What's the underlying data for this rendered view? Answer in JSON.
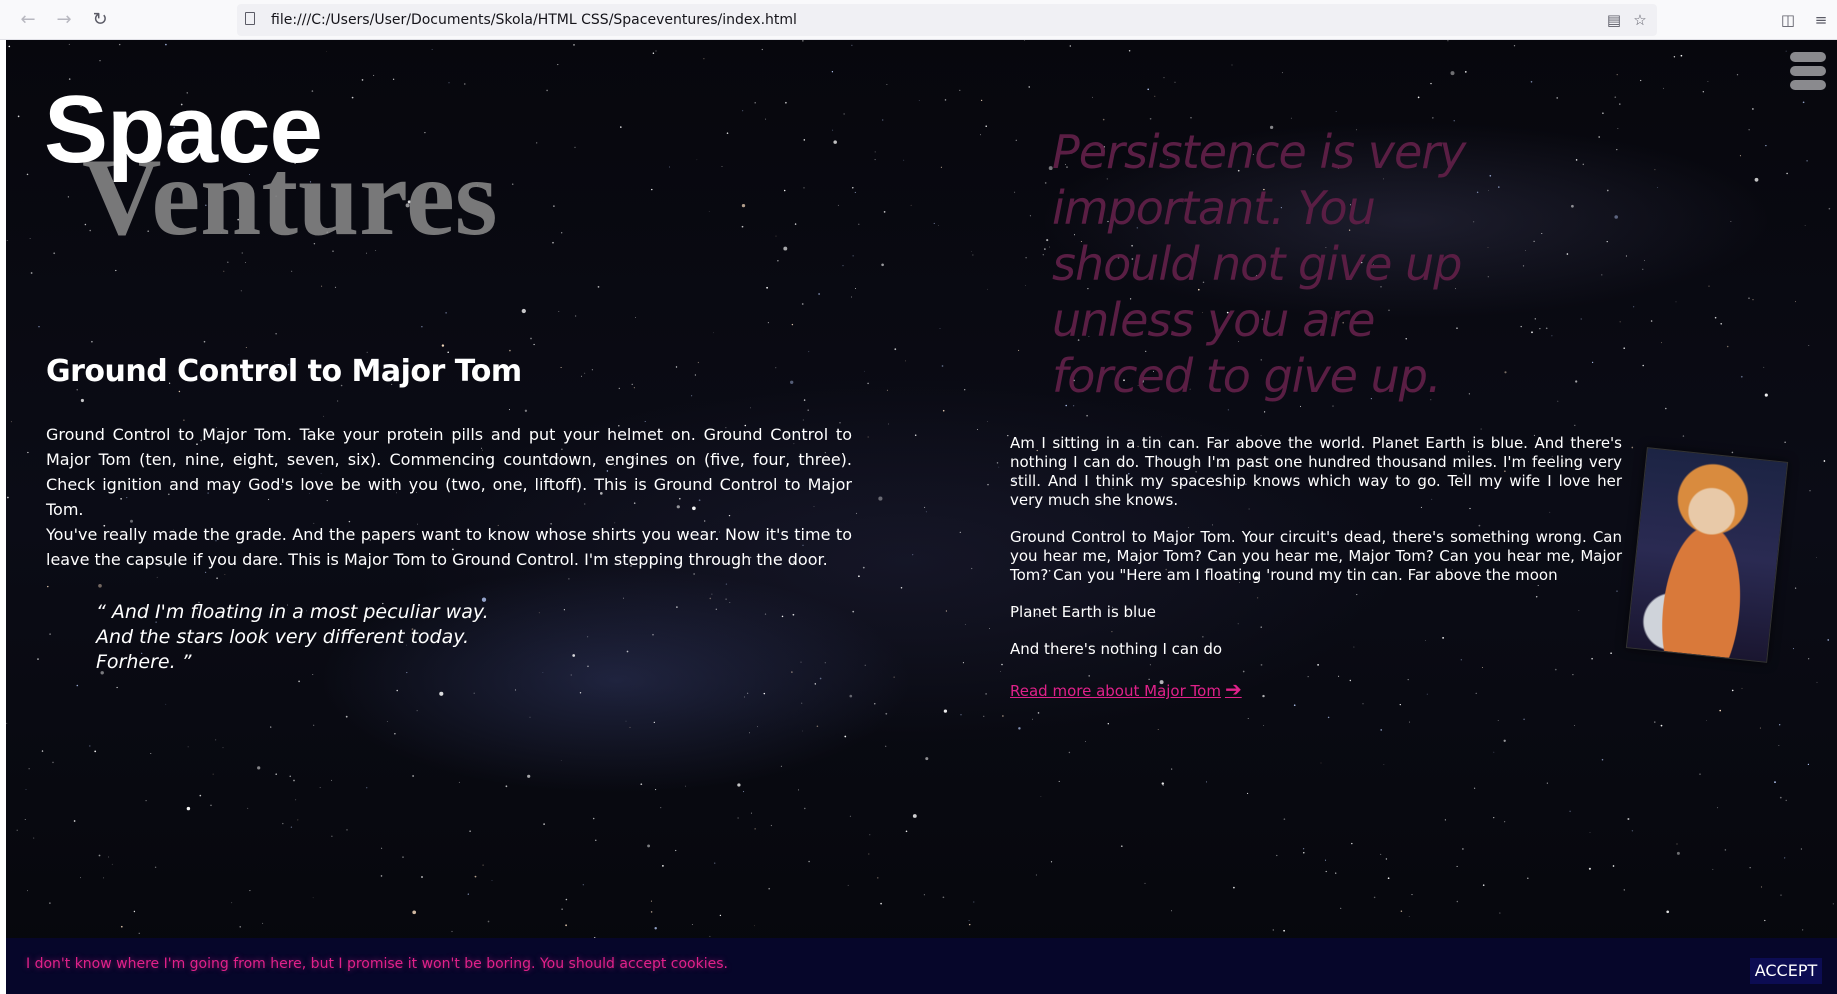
{
  "browser": {
    "back_icon": "←",
    "forward_icon": "→",
    "reload_icon": "↻",
    "url": "file:///C:/Users/User/Documents/Skola/HTML CSS/Spaceventures/index.html",
    "reader_icon": "▤",
    "bookmark_icon": "☆",
    "pocket_icon": "◫",
    "menu_icon": "≡"
  },
  "logo": {
    "space": "Space",
    "ventures": "Ventures"
  },
  "left": {
    "heading": "Ground Control to Major Tom",
    "para1": "Ground Control to Major Tom. Take your protein pills and put your helmet on. Ground Control to Major Tom (ten, nine, eight, seven, six). Commencing countdown, engines on (five, four, three). Check ignition and may God's love be with you (two, one, liftoff). This is Ground Control to Major Tom.",
    "para2": "You've really made the grade. And the papers want to know whose shirts you wear. Now it's time to leave the capsule if you dare. This is Major Tom to Ground Control. I'm stepping through the door.",
    "quote_line1": "“ And I'm floating in a most peculiar way.",
    "quote_line2": "And the stars look very different today.",
    "quote_line3": "Forhere. ”"
  },
  "right": {
    "big_quote": "Persistence is very important. You should not give up unless you are forced to give up.",
    "para1": "Am I sitting in a tin can. Far above the world. Planet Earth is blue. And there's nothing I can do. Though I'm past one hundred thousand miles. I'm feeling very still. And I think my spaceship knows which way to go. Tell my wife I love her very much she knows.",
    "para2": "Ground Control to Major Tom. Your circuit's dead, there's something wrong. Can you hear me, Major Tom? Can you hear me, Major Tom? Can you hear me, Major Tom? Can you \"Here am I floating 'round my tin can. Far above the moon",
    "para3": "Planet Earth is blue",
    "para4": "And there's nothing I can do",
    "read_more": "Read more about Major Tom",
    "read_more_arrow": "➔"
  },
  "cookie": {
    "message": "I don't know where I'm going from here, but I promise it won't be boring. You should accept cookies.",
    "accept_label": "ACCEPT"
  },
  "colors": {
    "accent_pink": "#e0218a",
    "quote_magenta": "#5a1e44",
    "cookie_bg": "#06062a",
    "accept_bg": "#0c0c52"
  }
}
